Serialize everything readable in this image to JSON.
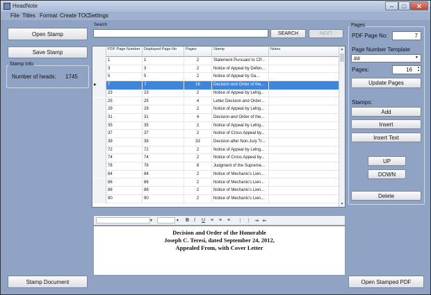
{
  "window": {
    "title": "HeadNote"
  },
  "menu": [
    "File",
    "Titles",
    "Format",
    "Create TOC",
    "Settings"
  ],
  "left": {
    "open_stamp": "Open Stamp",
    "save_stamp": "Save Stamp",
    "stamp_info_label": "Stamp Info",
    "number_of_heads_label": "Number of heads:",
    "number_of_heads_value": "1745",
    "stamp_document": "Stamp Document"
  },
  "search": {
    "label": "Search",
    "value": "",
    "search_button": "SEARCH",
    "next_button": "NEXT"
  },
  "grid": {
    "columns": [
      "PDF Page Number",
      "Displayed Page No",
      "Pages",
      "Stamp",
      "Notes"
    ],
    "rows": [
      [
        "1",
        "1",
        "2",
        "Statement Pursuant to CP...",
        ""
      ],
      [
        "3",
        "3",
        "2",
        "Notice of Appeal by Defen...",
        ""
      ],
      [
        "5",
        "5",
        "2",
        "Notice of Appeal by Ga...",
        ""
      ],
      [
        "7",
        "7",
        "16",
        "Decision and Order of the...",
        ""
      ],
      [
        "23",
        "23",
        "2",
        "Notice of Appeal by Lehig...",
        ""
      ],
      [
        "25",
        "25",
        "4",
        "Letter Decision and Order...",
        ""
      ],
      [
        "29",
        "29",
        "2",
        "Notice of Appeal by Lehig...",
        ""
      ],
      [
        "31",
        "31",
        "4",
        "Decision and Order of the...",
        ""
      ],
      [
        "35",
        "35",
        "2",
        "Notice of Appeal by Lehig...",
        ""
      ],
      [
        "37",
        "37",
        "2",
        "Notice of Cross Appeal by...",
        ""
      ],
      [
        "39",
        "39",
        "33",
        "Decision after Non-Jury Tr...",
        ""
      ],
      [
        "72",
        "72",
        "2",
        "Notice of Appeal by Lehig...",
        ""
      ],
      [
        "74",
        "74",
        "2",
        "Notice of Cross Appeal by...",
        ""
      ],
      [
        "76",
        "76",
        "8",
        "Judgment of the Supreme...",
        ""
      ],
      [
        "84",
        "84",
        "2",
        "Notice of Mechanic's Lien...",
        ""
      ],
      [
        "86",
        "86",
        "2",
        "Notice of Mechanic's Lien...",
        ""
      ],
      [
        "88",
        "88",
        "2",
        "Notice of Mechanic's Lien...",
        ""
      ],
      [
        "90",
        "90",
        "2",
        "Notice of Mechanic's Lien...",
        ""
      ]
    ],
    "selected_row": 3
  },
  "editor": {
    "lines": [
      "Decision and Order of the Honorable",
      "Joseph C. Teresi, dated September 24, 2012,",
      "Appealed From, with Cover Letter"
    ]
  },
  "pages": {
    "label": "Pages",
    "pdf_page_no_label": "PDF Page No:",
    "pdf_page_no_value": "7",
    "page_number_template_label": "Page Number Template",
    "template_value": "##",
    "pages_label": "Pages:",
    "pages_value": "16",
    "update_pages": "Update Pages",
    "stamps_label": "Stamps:",
    "add": "Add",
    "insert": "Insert",
    "insert_text": "Insert Text",
    "up": "UP",
    "down": "DOWN",
    "delete": "Delete",
    "open_stamped_pdf": "Open Stamped PDF"
  }
}
